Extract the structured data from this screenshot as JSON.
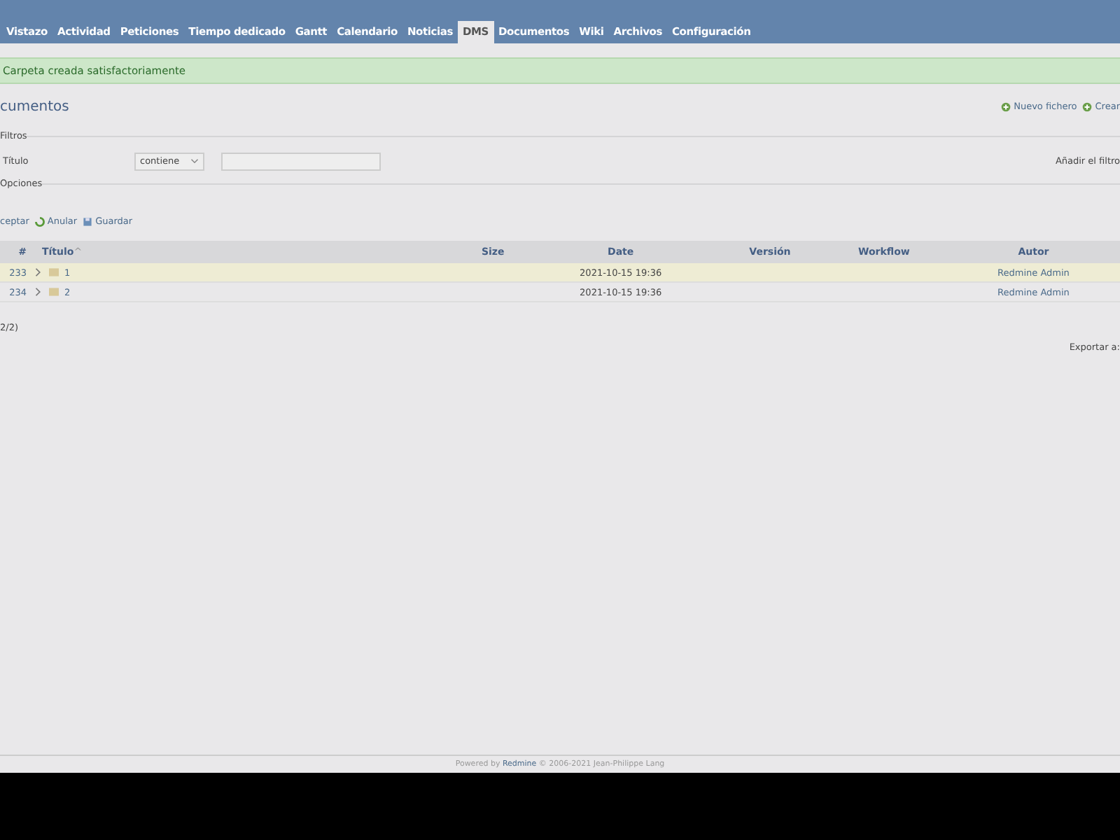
{
  "tabs": [
    {
      "label": "Vistazo",
      "selected": false
    },
    {
      "label": "Actividad",
      "selected": false
    },
    {
      "label": "Peticiones",
      "selected": false
    },
    {
      "label": "Tiempo dedicado",
      "selected": false
    },
    {
      "label": "Gantt",
      "selected": false
    },
    {
      "label": "Calendario",
      "selected": false
    },
    {
      "label": "Noticias",
      "selected": false
    },
    {
      "label": "DMS",
      "selected": true
    },
    {
      "label": "Documentos",
      "selected": false
    },
    {
      "label": "Wiki",
      "selected": false
    },
    {
      "label": "Archivos",
      "selected": false
    },
    {
      "label": "Configuración",
      "selected": false
    }
  ],
  "flash": "Carpeta creada satisfactoriamente",
  "title": "cumentos",
  "actions": [
    "Nuevo fichero",
    "Crear"
  ],
  "filters": {
    "legend": "Filtros",
    "field": "Título",
    "operator": "contiene",
    "add_filter": "Añadir el filtro"
  },
  "options": {
    "legend": "Opciones"
  },
  "buttons": [
    {
      "kind": "apply",
      "label": "ceptar"
    },
    {
      "kind": "clear",
      "label": "Anular"
    },
    {
      "kind": "save",
      "label": "Guardar"
    }
  ],
  "table": {
    "columns": [
      "#",
      "Título",
      "Size",
      "Date",
      "Versión",
      "Workflow",
      "Autor"
    ],
    "sort_mark": "^",
    "rows": [
      {
        "id": "233",
        "title": "1",
        "size": "",
        "date": "2021-10-15 19:36",
        "author": "Redmine Admin",
        "highlighted": true
      },
      {
        "id": "234",
        "title": "2",
        "size": "",
        "date": "2021-10-15 19:36",
        "author": "Redmine Admin",
        "highlighted": false
      }
    ]
  },
  "pagination": "2/2)",
  "export": "Exportar a:",
  "footer": {
    "prefix": "Powered by",
    "link": "Redmine",
    "suffix": "© 2006-2021 Jean-Philippe Lang"
  }
}
